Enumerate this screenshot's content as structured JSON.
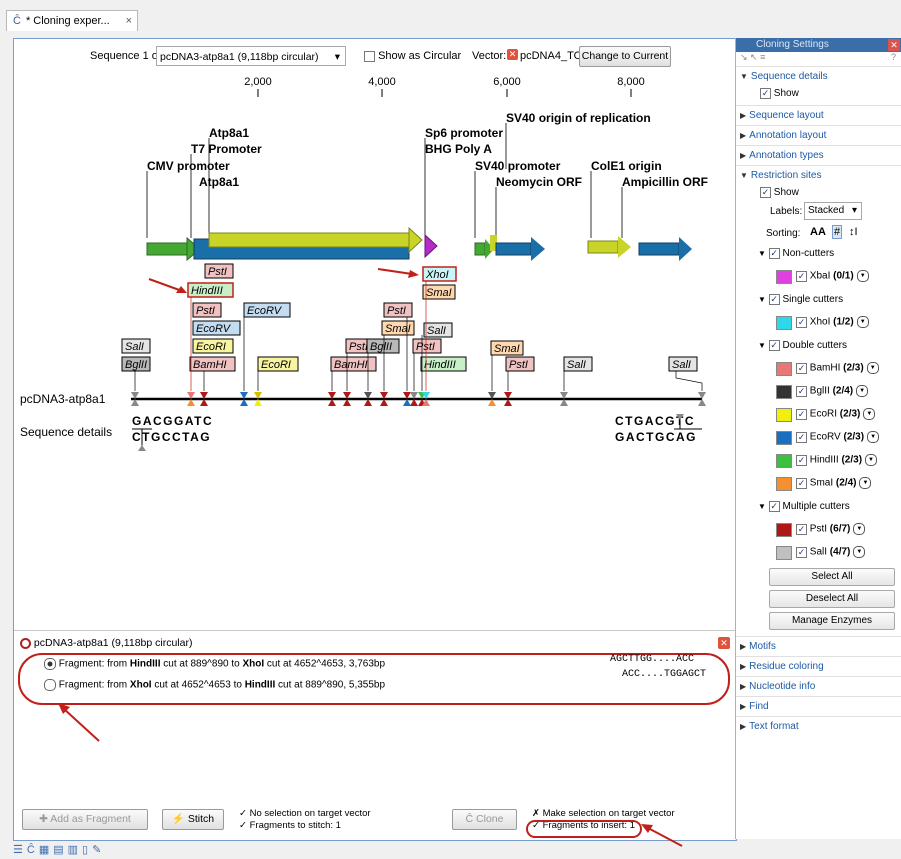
{
  "tab": {
    "title": "* Cloning exper...",
    "close": "×"
  },
  "topbar": {
    "sequence_label": "Sequence 1 of 2:",
    "sequence_value": "pcDNA3-atp8a1 (9,118bp circular)",
    "show_circular": "Show as Circular",
    "vector_label": "Vector:",
    "vector_value": "pcDNA4_TO",
    "change_button": "Change to Current"
  },
  "ruler": [
    "2,000",
    "4,000",
    "6,000",
    "8,000"
  ],
  "annotations": [
    {
      "label": "SV40 origin of replication"
    },
    {
      "label": "Atp8a1"
    },
    {
      "label": "T7 Promoter"
    },
    {
      "label": "Sp6 promoter"
    },
    {
      "label": "BHG Poly A"
    },
    {
      "label": "CMV promoter"
    },
    {
      "label": "SV40 promoter"
    },
    {
      "label": "ColE1 origin"
    },
    {
      "label": "Atp8a1"
    },
    {
      "label": "Neomycin ORF"
    },
    {
      "label": "Ampicillin ORF"
    }
  ],
  "enzymes": [
    "PstI",
    "HindIII",
    "PstI",
    "EcoRV",
    "EcoRI",
    "BamHI",
    "SalI",
    "BglII",
    "EcoRV",
    "EcoRI",
    "PstI",
    "BamHI",
    "BglII",
    "PstI",
    "SmaI",
    "PstI",
    "SalI",
    "PstI",
    "HindIII",
    "XhoI",
    "SmaI",
    "SmaI",
    "PstI",
    "SalI",
    "SalI"
  ],
  "sequence": {
    "name": "pcDNA3-atp8a1",
    "details_label": "Sequence details",
    "left_top": "GACGGATC",
    "left_bottom": "CTGCCTAG",
    "right_top": "CTGACGTC",
    "right_bottom": "GACTGCAG"
  },
  "fragments": {
    "header": "pcDNA3-atp8a1 (9,118bp circular)",
    "items": [
      {
        "prefix": "Fragment: from ",
        "e1": "HindIII",
        "mid": " cut at 889^890 to ",
        "e2": "XhoI",
        "suffix": " cut at 4652^4653, 3,763bp",
        "seq": "AGCTTGG....ACC",
        "selected": true
      },
      {
        "prefix": "Fragment: from ",
        "e1": "XhoI",
        "mid": " cut at 4652^4653 to ",
        "e2": "HindIII",
        "suffix": " cut at 889^890, 5,355bp",
        "seq": "ACC....TGGAGCT",
        "selected": false
      }
    ]
  },
  "bottom": {
    "add_fragment": "Add as Fragment",
    "stitch": "Stitch",
    "stitch_status_1": "✓ No selection on target vector",
    "stitch_status_2": "✓ Fragments to stitch: 1",
    "clone": "Clone",
    "clone_status_1": "✗ Make selection on target vector",
    "clone_status_2": "✓ Fragments to insert: 1"
  },
  "side": {
    "title": "Cloning Settings",
    "help": "?",
    "sequence_details": "Sequence details",
    "show": "Show",
    "sequence_layout": "Sequence layout",
    "annotation_layout": "Annotation layout",
    "annotation_types": "Annotation types",
    "restriction_sites": "Restriction sites",
    "show2": "Show",
    "labels_label": "Labels:",
    "labels_value": "Stacked",
    "sorting_label": "Sorting:",
    "groups": {
      "non_cutters": "Non-cutters",
      "single_cutters": "Single cutters",
      "double_cutters": "Double cutters",
      "multiple_cutters": "Multiple cutters"
    },
    "enzyme_rows": [
      {
        "name": "XbaI",
        "count": "(0/1)",
        "color": "#e040e0"
      },
      {
        "name": "XhoI",
        "count": "(1/2)",
        "color": "#2fd8e8"
      },
      {
        "name": "BamHI",
        "count": "(2/3)",
        "color": "#e87878"
      },
      {
        "name": "BglII",
        "count": "(2/4)",
        "color": "#333333"
      },
      {
        "name": "EcoRI",
        "count": "(2/3)",
        "color": "#f0f010"
      },
      {
        "name": "EcoRV",
        "count": "(2/3)",
        "color": "#1a6fc0"
      },
      {
        "name": "HindIII",
        "count": "(2/3)",
        "color": "#3cc040"
      },
      {
        "name": "SmaI",
        "count": "(2/4)",
        "color": "#f59030"
      },
      {
        "name": "PstI",
        "count": "(6/7)",
        "color": "#b01818"
      },
      {
        "name": "SalI",
        "count": "(4/7)",
        "color": "#c0c0c0"
      }
    ],
    "select_all": "Select All",
    "deselect_all": "Deselect All",
    "manage_enzymes": "Manage Enzymes",
    "collapsed": [
      "Motifs",
      "Residue coloring",
      "Nucleotide info",
      "Find",
      "Text format"
    ]
  }
}
